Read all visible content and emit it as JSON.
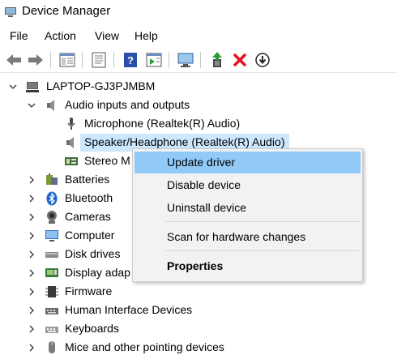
{
  "window": {
    "title": "Device Manager"
  },
  "menubar": {
    "items": [
      "File",
      "Action",
      "View",
      "Help"
    ]
  },
  "toolbar": {
    "buttons": [
      {
        "icon": "back-arrow-icon"
      },
      {
        "icon": "forward-arrow-icon"
      },
      {
        "icon": "show-hide-console-tree-icon"
      },
      {
        "icon": "properties-icon"
      },
      {
        "icon": "help-icon"
      },
      {
        "icon": "action-pane-icon"
      },
      {
        "icon": "scan-hardware-icon"
      },
      {
        "icon": "update-driver-icon"
      },
      {
        "icon": "uninstall-device-icon"
      },
      {
        "icon": "disable-device-icon"
      }
    ]
  },
  "tree": {
    "root": "LAPTOP-GJ3PJMBM",
    "audio_category": "Audio inputs and outputs",
    "audio_children": [
      "Microphone (Realtek(R) Audio)",
      "Speaker/Headphone (Realtek(R) Audio)",
      "Stereo M"
    ],
    "categories": [
      "Batteries",
      "Bluetooth",
      "Cameras",
      "Computer",
      "Disk drives",
      "Display adap",
      "Firmware",
      "Human Interface Devices",
      "Keyboards",
      "Mice and other pointing devices"
    ]
  },
  "context_menu": {
    "update_driver": "Update driver",
    "disable_device": "Disable device",
    "uninstall_device": "Uninstall device",
    "scan": "Scan for hardware changes",
    "properties": "Properties"
  },
  "colors": {
    "selection": "#cce8ff",
    "menu_hover": "#91c9f7",
    "menu_bg": "#f2f2f2",
    "delete_red": "#e81123"
  }
}
